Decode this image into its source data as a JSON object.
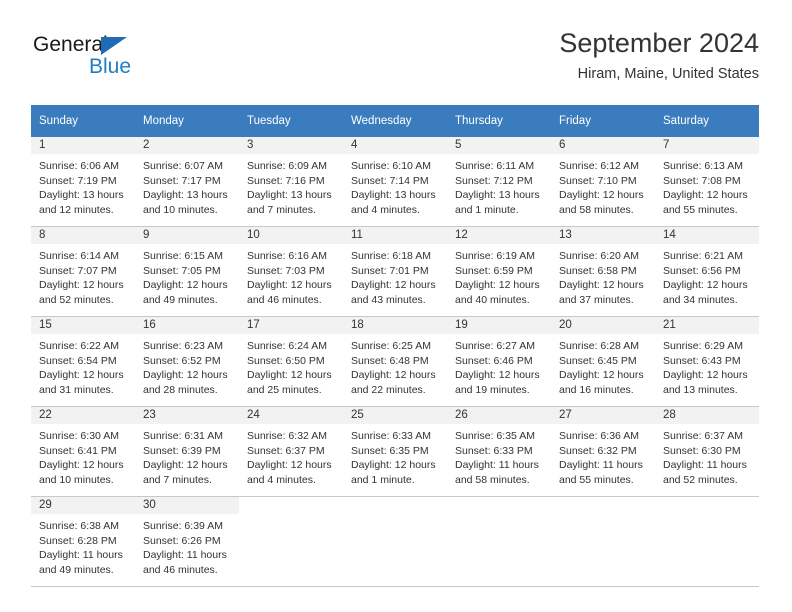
{
  "branding": {
    "logo_text_primary": "General",
    "logo_text_secondary": "Blue",
    "logo_primary_color": "#1a1a1a",
    "logo_secondary_color": "#1f7ec4",
    "logo_triangle_color": "#1f6cb4"
  },
  "header": {
    "title": "September 2024",
    "subtitle": "Hiram, Maine, United States"
  },
  "theme": {
    "header_row_bg": "#3a7cbe",
    "header_row_text": "#ffffff",
    "daynum_band_bg": "#f2f2f2",
    "row_divider": "#c8c8c8",
    "body_text": "#333333"
  },
  "weekdays": [
    "Sunday",
    "Monday",
    "Tuesday",
    "Wednesday",
    "Thursday",
    "Friday",
    "Saturday"
  ],
  "weeks": [
    [
      {
        "day": "1",
        "sunrise": "Sunrise: 6:06 AM",
        "sunset": "Sunset: 7:19 PM",
        "daylight_line1": "Daylight: 13 hours",
        "daylight_line2": "and 12 minutes."
      },
      {
        "day": "2",
        "sunrise": "Sunrise: 6:07 AM",
        "sunset": "Sunset: 7:17 PM",
        "daylight_line1": "Daylight: 13 hours",
        "daylight_line2": "and 10 minutes."
      },
      {
        "day": "3",
        "sunrise": "Sunrise: 6:09 AM",
        "sunset": "Sunset: 7:16 PM",
        "daylight_line1": "Daylight: 13 hours",
        "daylight_line2": "and 7 minutes."
      },
      {
        "day": "4",
        "sunrise": "Sunrise: 6:10 AM",
        "sunset": "Sunset: 7:14 PM",
        "daylight_line1": "Daylight: 13 hours",
        "daylight_line2": "and 4 minutes."
      },
      {
        "day": "5",
        "sunrise": "Sunrise: 6:11 AM",
        "sunset": "Sunset: 7:12 PM",
        "daylight_line1": "Daylight: 13 hours",
        "daylight_line2": "and 1 minute."
      },
      {
        "day": "6",
        "sunrise": "Sunrise: 6:12 AM",
        "sunset": "Sunset: 7:10 PM",
        "daylight_line1": "Daylight: 12 hours",
        "daylight_line2": "and 58 minutes."
      },
      {
        "day": "7",
        "sunrise": "Sunrise: 6:13 AM",
        "sunset": "Sunset: 7:08 PM",
        "daylight_line1": "Daylight: 12 hours",
        "daylight_line2": "and 55 minutes."
      }
    ],
    [
      {
        "day": "8",
        "sunrise": "Sunrise: 6:14 AM",
        "sunset": "Sunset: 7:07 PM",
        "daylight_line1": "Daylight: 12 hours",
        "daylight_line2": "and 52 minutes."
      },
      {
        "day": "9",
        "sunrise": "Sunrise: 6:15 AM",
        "sunset": "Sunset: 7:05 PM",
        "daylight_line1": "Daylight: 12 hours",
        "daylight_line2": "and 49 minutes."
      },
      {
        "day": "10",
        "sunrise": "Sunrise: 6:16 AM",
        "sunset": "Sunset: 7:03 PM",
        "daylight_line1": "Daylight: 12 hours",
        "daylight_line2": "and 46 minutes."
      },
      {
        "day": "11",
        "sunrise": "Sunrise: 6:18 AM",
        "sunset": "Sunset: 7:01 PM",
        "daylight_line1": "Daylight: 12 hours",
        "daylight_line2": "and 43 minutes."
      },
      {
        "day": "12",
        "sunrise": "Sunrise: 6:19 AM",
        "sunset": "Sunset: 6:59 PM",
        "daylight_line1": "Daylight: 12 hours",
        "daylight_line2": "and 40 minutes."
      },
      {
        "day": "13",
        "sunrise": "Sunrise: 6:20 AM",
        "sunset": "Sunset: 6:58 PM",
        "daylight_line1": "Daylight: 12 hours",
        "daylight_line2": "and 37 minutes."
      },
      {
        "day": "14",
        "sunrise": "Sunrise: 6:21 AM",
        "sunset": "Sunset: 6:56 PM",
        "daylight_line1": "Daylight: 12 hours",
        "daylight_line2": "and 34 minutes."
      }
    ],
    [
      {
        "day": "15",
        "sunrise": "Sunrise: 6:22 AM",
        "sunset": "Sunset: 6:54 PM",
        "daylight_line1": "Daylight: 12 hours",
        "daylight_line2": "and 31 minutes."
      },
      {
        "day": "16",
        "sunrise": "Sunrise: 6:23 AM",
        "sunset": "Sunset: 6:52 PM",
        "daylight_line1": "Daylight: 12 hours",
        "daylight_line2": "and 28 minutes."
      },
      {
        "day": "17",
        "sunrise": "Sunrise: 6:24 AM",
        "sunset": "Sunset: 6:50 PM",
        "daylight_line1": "Daylight: 12 hours",
        "daylight_line2": "and 25 minutes."
      },
      {
        "day": "18",
        "sunrise": "Sunrise: 6:25 AM",
        "sunset": "Sunset: 6:48 PM",
        "daylight_line1": "Daylight: 12 hours",
        "daylight_line2": "and 22 minutes."
      },
      {
        "day": "19",
        "sunrise": "Sunrise: 6:27 AM",
        "sunset": "Sunset: 6:46 PM",
        "daylight_line1": "Daylight: 12 hours",
        "daylight_line2": "and 19 minutes."
      },
      {
        "day": "20",
        "sunrise": "Sunrise: 6:28 AM",
        "sunset": "Sunset: 6:45 PM",
        "daylight_line1": "Daylight: 12 hours",
        "daylight_line2": "and 16 minutes."
      },
      {
        "day": "21",
        "sunrise": "Sunrise: 6:29 AM",
        "sunset": "Sunset: 6:43 PM",
        "daylight_line1": "Daylight: 12 hours",
        "daylight_line2": "and 13 minutes."
      }
    ],
    [
      {
        "day": "22",
        "sunrise": "Sunrise: 6:30 AM",
        "sunset": "Sunset: 6:41 PM",
        "daylight_line1": "Daylight: 12 hours",
        "daylight_line2": "and 10 minutes."
      },
      {
        "day": "23",
        "sunrise": "Sunrise: 6:31 AM",
        "sunset": "Sunset: 6:39 PM",
        "daylight_line1": "Daylight: 12 hours",
        "daylight_line2": "and 7 minutes."
      },
      {
        "day": "24",
        "sunrise": "Sunrise: 6:32 AM",
        "sunset": "Sunset: 6:37 PM",
        "daylight_line1": "Daylight: 12 hours",
        "daylight_line2": "and 4 minutes."
      },
      {
        "day": "25",
        "sunrise": "Sunrise: 6:33 AM",
        "sunset": "Sunset: 6:35 PM",
        "daylight_line1": "Daylight: 12 hours",
        "daylight_line2": "and 1 minute."
      },
      {
        "day": "26",
        "sunrise": "Sunrise: 6:35 AM",
        "sunset": "Sunset: 6:33 PM",
        "daylight_line1": "Daylight: 11 hours",
        "daylight_line2": "and 58 minutes."
      },
      {
        "day": "27",
        "sunrise": "Sunrise: 6:36 AM",
        "sunset": "Sunset: 6:32 PM",
        "daylight_line1": "Daylight: 11 hours",
        "daylight_line2": "and 55 minutes."
      },
      {
        "day": "28",
        "sunrise": "Sunrise: 6:37 AM",
        "sunset": "Sunset: 6:30 PM",
        "daylight_line1": "Daylight: 11 hours",
        "daylight_line2": "and 52 minutes."
      }
    ],
    [
      {
        "day": "29",
        "sunrise": "Sunrise: 6:38 AM",
        "sunset": "Sunset: 6:28 PM",
        "daylight_line1": "Daylight: 11 hours",
        "daylight_line2": "and 49 minutes."
      },
      {
        "day": "30",
        "sunrise": "Sunrise: 6:39 AM",
        "sunset": "Sunset: 6:26 PM",
        "daylight_line1": "Daylight: 11 hours",
        "daylight_line2": "and 46 minutes."
      },
      {
        "day": "",
        "sunrise": "",
        "sunset": "",
        "daylight_line1": "",
        "daylight_line2": ""
      },
      {
        "day": "",
        "sunrise": "",
        "sunset": "",
        "daylight_line1": "",
        "daylight_line2": ""
      },
      {
        "day": "",
        "sunrise": "",
        "sunset": "",
        "daylight_line1": "",
        "daylight_line2": ""
      },
      {
        "day": "",
        "sunrise": "",
        "sunset": "",
        "daylight_line1": "",
        "daylight_line2": ""
      },
      {
        "day": "",
        "sunrise": "",
        "sunset": "",
        "daylight_line1": "",
        "daylight_line2": ""
      }
    ]
  ]
}
